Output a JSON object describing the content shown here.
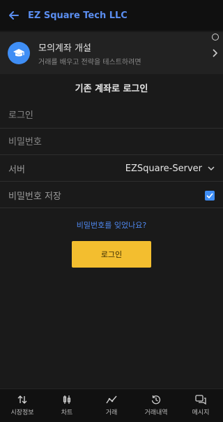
{
  "header": {
    "title": "EZ Square Tech LLC"
  },
  "promo": {
    "title": "모의계좌 개설",
    "subtitle": "거래를 배우고 전략을 테스트하려면"
  },
  "login": {
    "heading": "기존 계좌로 로그인",
    "login_placeholder": "로그인",
    "password_placeholder": "비밀번호",
    "server_label": "서버",
    "server_value": "EZSquare-Server",
    "save_password_label": "비밀번호 저장",
    "save_password_checked": true,
    "forgot_password": "비밀번호를 잊었나요?",
    "login_button": "로그인"
  },
  "tabs": [
    {
      "label": "시장정보",
      "icon": "arrows-updown-icon"
    },
    {
      "label": "차트",
      "icon": "candlestick-icon"
    },
    {
      "label": "거래",
      "icon": "trend-line-icon"
    },
    {
      "label": "거래내역",
      "icon": "history-icon"
    },
    {
      "label": "메시지",
      "icon": "chat-icon"
    }
  ],
  "colors": {
    "accent": "#3f8ef5",
    "button": "#f3be2f",
    "background": "#1a1a1a"
  }
}
